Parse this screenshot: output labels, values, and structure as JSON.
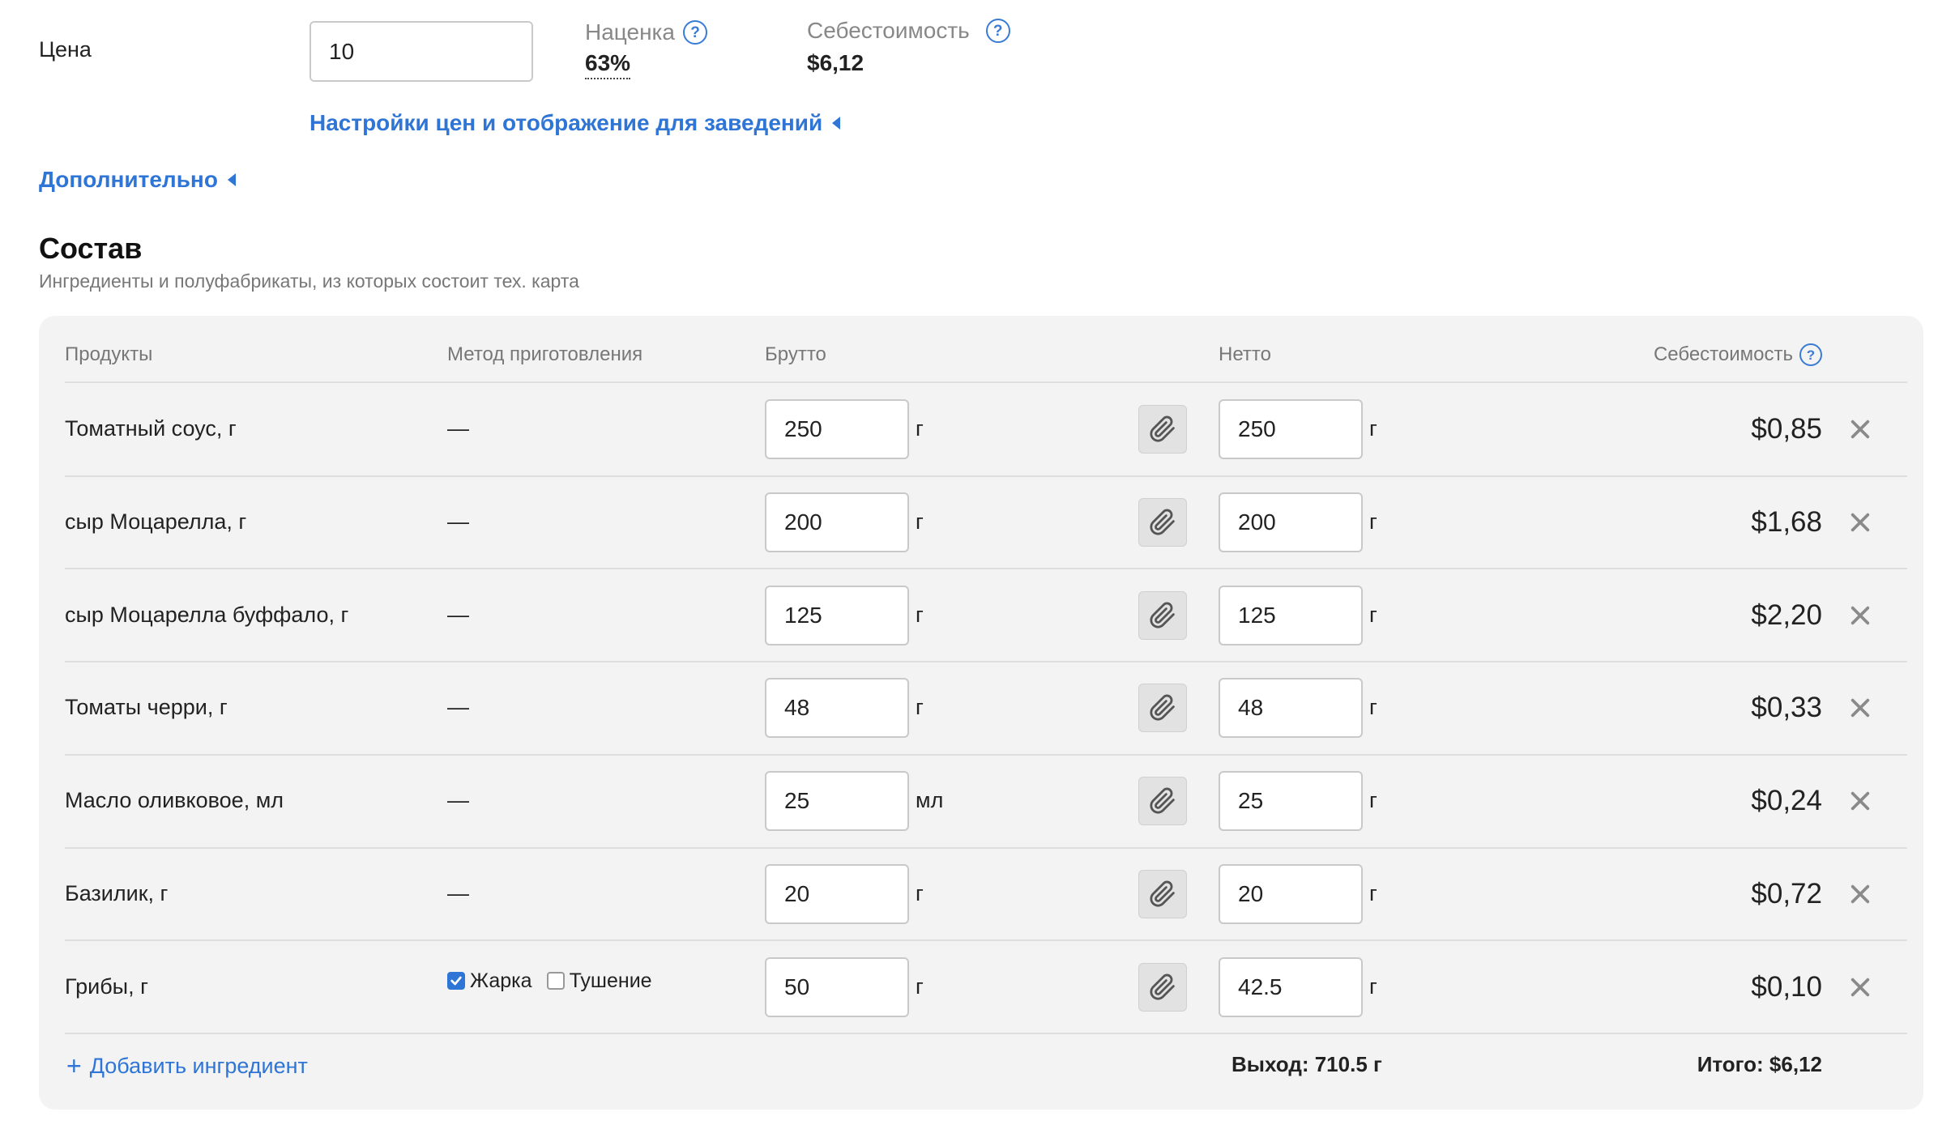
{
  "price": {
    "label": "Цена",
    "value": "10",
    "currency": "$"
  },
  "markup": {
    "label": "Наценка",
    "value": "63%"
  },
  "cost_summary": {
    "label": "Себестоимость",
    "value": "$6,12"
  },
  "links": {
    "price_settings": "Настройки цен и отображение для заведений",
    "additional": "Дополнительно"
  },
  "composition": {
    "title": "Состав",
    "subtitle": "Ингредиенты и полуфабрикаты, из которых состоит тех. карта"
  },
  "table": {
    "headers": {
      "products": "Продукты",
      "method": "Метод приготовления",
      "gross": "Брутто",
      "net": "Нетто",
      "cost": "Себестоимость"
    },
    "rows": [
      {
        "name": "Томатный соус, г",
        "method": "—",
        "gross": "250",
        "gross_unit": "г",
        "net": "250",
        "net_unit": "г",
        "cost": "$0,85"
      },
      {
        "name": "сыр Моцарелла, г",
        "method": "—",
        "gross": "200",
        "gross_unit": "г",
        "net": "200",
        "net_unit": "г",
        "cost": "$1,68"
      },
      {
        "name": "сыр Моцарелла буффало, г",
        "method": "—",
        "gross": "125",
        "gross_unit": "г",
        "net": "125",
        "net_unit": "г",
        "cost": "$2,20"
      },
      {
        "name": "Томаты черри, г",
        "method": "—",
        "gross": "48",
        "gross_unit": "г",
        "net": "48",
        "net_unit": "г",
        "cost": "$0,33"
      },
      {
        "name": "Масло оливковое, мл",
        "method": "—",
        "gross": "25",
        "gross_unit": "мл",
        "net": "25",
        "net_unit": "г",
        "cost": "$0,24"
      },
      {
        "name": "Базилик, г",
        "method": "—",
        "gross": "20",
        "gross_unit": "г",
        "net": "20",
        "net_unit": "г",
        "cost": "$0,72"
      },
      {
        "name": "Грибы, г",
        "method_options": [
          {
            "label": "Жарка",
            "checked": true
          },
          {
            "label": "Тушение",
            "checked": false
          }
        ],
        "gross": "50",
        "gross_unit": "г",
        "net": "42.5",
        "net_unit": "г",
        "cost": "$0,10"
      }
    ],
    "footer": {
      "add_label": "Добавить ингредиент",
      "add_icon": "+",
      "yield": "Выход: 710.5 г",
      "total": "Итого: $6,12"
    }
  },
  "icons": {
    "help": "?",
    "attach": "paperclip-icon",
    "remove": "close-icon",
    "collapse": "caret-left-icon"
  },
  "colors": {
    "accent": "#2f75d6",
    "panel_bg": "#f3f3f3"
  }
}
